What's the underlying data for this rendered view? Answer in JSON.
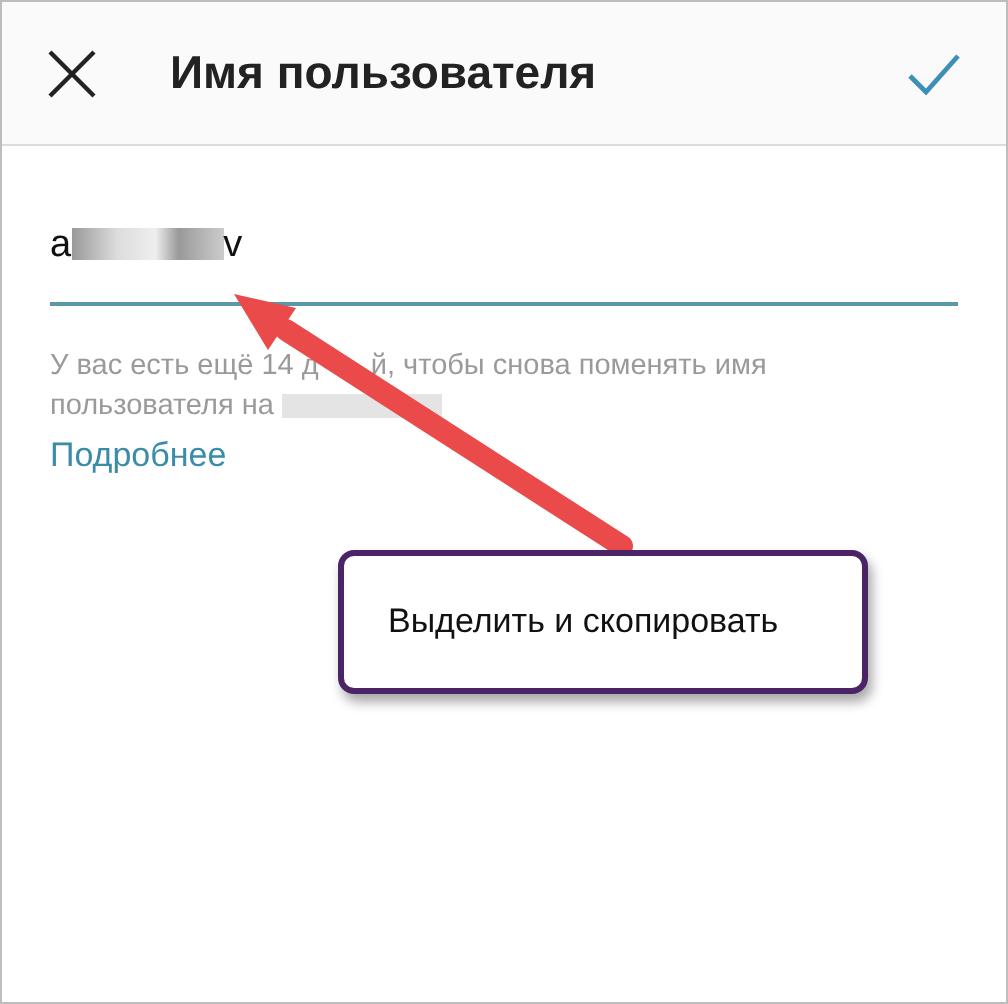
{
  "header": {
    "title": "Имя пользователя"
  },
  "username_field": {
    "value_start": "a",
    "value_end": "v"
  },
  "hint": {
    "line_1_start": "У вас есть ещё 14 д",
    "line_1_end": "й, чтобы снова поменять имя",
    "line_2": "пользователя на"
  },
  "link": "Подробнее",
  "callout": {
    "text": "Выделить и скопировать"
  }
}
